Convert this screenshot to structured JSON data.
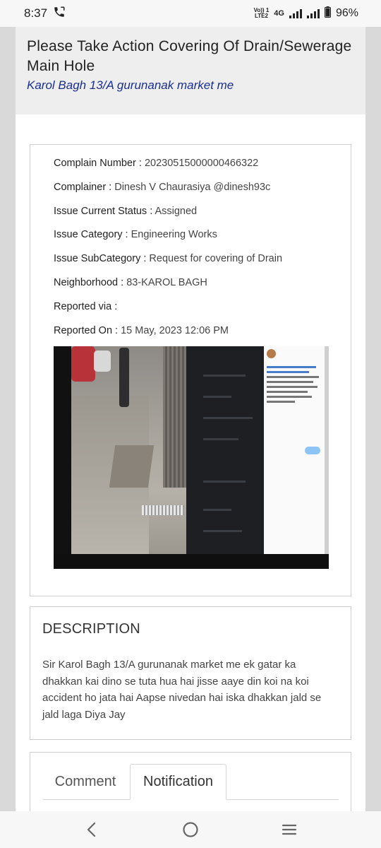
{
  "status_bar": {
    "time": "8:37",
    "volte_top": "Vo)) 1",
    "volte_bottom": "LTE2",
    "network": "4G",
    "battery": "96%"
  },
  "header": {
    "title": "Please Take Action Covering Of Drain/Sewerage Main Hole",
    "subtitle": "Karol Bagh 13/A gurunanak market me"
  },
  "complaint": {
    "rows": [
      {
        "label": "Complain Number :",
        "value": "20230515000000466322"
      },
      {
        "label": "Complainer :",
        "value": "Dinesh V Chaurasiya @dinesh93c"
      },
      {
        "label": "Issue Current Status :",
        "value": "Assigned"
      },
      {
        "label": "Issue Category :",
        "value": "Engineering Works"
      },
      {
        "label": "Issue SubCategory :",
        "value": "Request for covering of Drain"
      },
      {
        "label": "Neighborhood :",
        "value": "83-KAROL BAGH"
      },
      {
        "label": "Reported via :",
        "value": ""
      },
      {
        "label": "Reported On :",
        "value": "15 May, 2023 12:06 PM"
      }
    ]
  },
  "description": {
    "title": "DESCRIPTION",
    "text": "Sir Karol Bagh 13/A gurunanak market me ek gatar ka dhakkan kai dino se tuta hua hai jisse aaye din koi na koi accident ho jata hai Aapse nivedan hai iska dhakkan jald se jald laga Diya Jay"
  },
  "tabs": {
    "comment": "Comment",
    "notification": "Notification",
    "active": "Notification"
  },
  "icons": {
    "call": "call-icon",
    "signal": "signal-icon",
    "battery": "battery-icon",
    "back": "back-icon",
    "home": "home-icon",
    "recents": "recents-icon"
  },
  "colors": {
    "header_band": "#eeeeee",
    "subtitle": "#1a2f8e",
    "page_background": "#d9d9d9"
  }
}
